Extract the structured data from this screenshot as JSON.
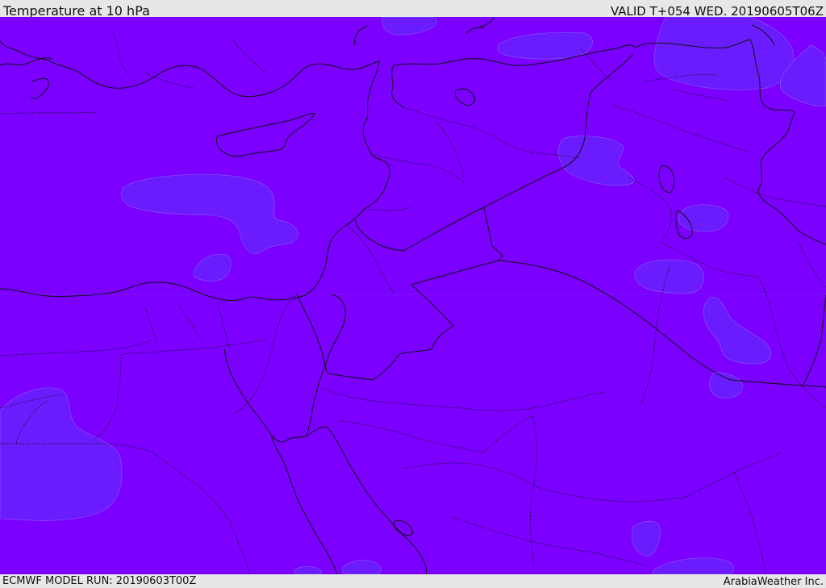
{
  "header": {
    "title": "Temperature at 10 hPa",
    "valid": "VALID T+054 WED. 20190605T06Z"
  },
  "footer": {
    "model_run": "ECMWF MODEL RUN: 20190603T00Z",
    "credit": "ArabiaWeather Inc."
  },
  "map": {
    "base_fill_color": "#7b00ff",
    "patch_fill_color": "#6a1eff",
    "outline_color": "#111111"
  }
}
